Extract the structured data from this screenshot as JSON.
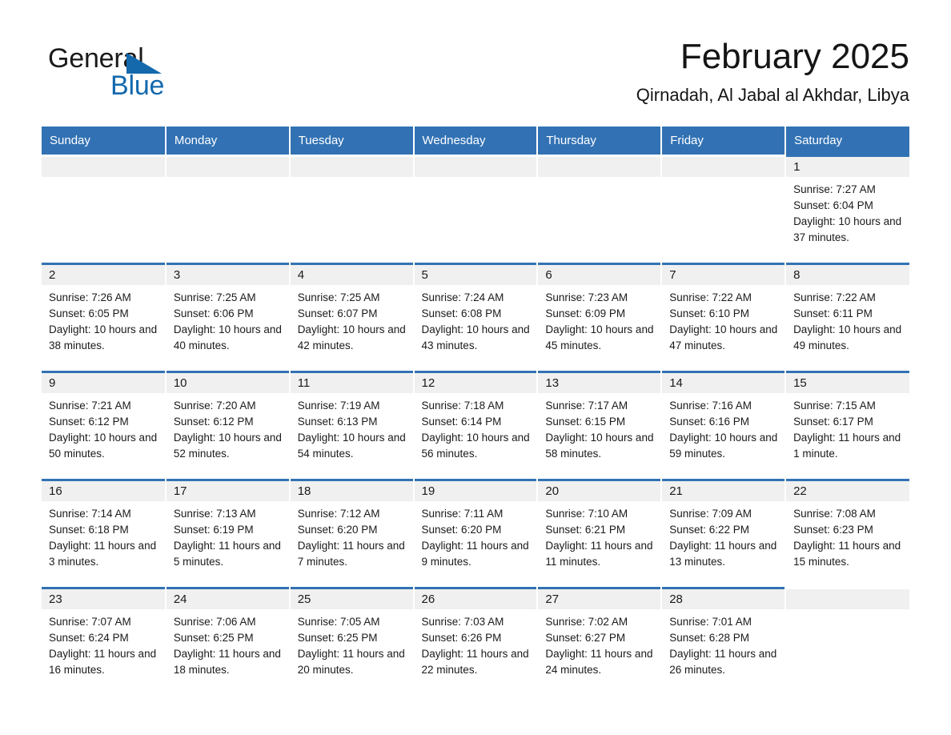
{
  "logo": {
    "word1": "General",
    "word2": "Blue",
    "triangle_color": "#1469ad",
    "word2_color": "#1469ad"
  },
  "header": {
    "title": "February 2025",
    "subtitle": "Qirnadah, Al Jabal al Akhdar, Libya"
  },
  "theme": {
    "header_blue": "#3272b4",
    "day_band_grey": "#f0f0f0",
    "text": "#1a1a1a"
  },
  "weekdays": [
    "Sunday",
    "Monday",
    "Tuesday",
    "Wednesday",
    "Thursday",
    "Friday",
    "Saturday"
  ],
  "labels": {
    "sunrise_prefix": "Sunrise:",
    "sunset_prefix": "Sunset:",
    "daylight_prefix": "Daylight:"
  },
  "weeks": [
    [
      {
        "day": "",
        "empty": true
      },
      {
        "day": "",
        "empty": true
      },
      {
        "day": "",
        "empty": true
      },
      {
        "day": "",
        "empty": true
      },
      {
        "day": "",
        "empty": true
      },
      {
        "day": "",
        "empty": true
      },
      {
        "day": "1",
        "sunrise": "Sunrise: 7:27 AM",
        "sunset": "Sunset: 6:04 PM",
        "daylight": "Daylight: 10 hours and 37 minutes."
      }
    ],
    [
      {
        "day": "2",
        "sunrise": "Sunrise: 7:26 AM",
        "sunset": "Sunset: 6:05 PM",
        "daylight": "Daylight: 10 hours and 38 minutes."
      },
      {
        "day": "3",
        "sunrise": "Sunrise: 7:25 AM",
        "sunset": "Sunset: 6:06 PM",
        "daylight": "Daylight: 10 hours and 40 minutes."
      },
      {
        "day": "4",
        "sunrise": "Sunrise: 7:25 AM",
        "sunset": "Sunset: 6:07 PM",
        "daylight": "Daylight: 10 hours and 42 minutes."
      },
      {
        "day": "5",
        "sunrise": "Sunrise: 7:24 AM",
        "sunset": "Sunset: 6:08 PM",
        "daylight": "Daylight: 10 hours and 43 minutes."
      },
      {
        "day": "6",
        "sunrise": "Sunrise: 7:23 AM",
        "sunset": "Sunset: 6:09 PM",
        "daylight": "Daylight: 10 hours and 45 minutes."
      },
      {
        "day": "7",
        "sunrise": "Sunrise: 7:22 AM",
        "sunset": "Sunset: 6:10 PM",
        "daylight": "Daylight: 10 hours and 47 minutes."
      },
      {
        "day": "8",
        "sunrise": "Sunrise: 7:22 AM",
        "sunset": "Sunset: 6:11 PM",
        "daylight": "Daylight: 10 hours and 49 minutes."
      }
    ],
    [
      {
        "day": "9",
        "sunrise": "Sunrise: 7:21 AM",
        "sunset": "Sunset: 6:12 PM",
        "daylight": "Daylight: 10 hours and 50 minutes."
      },
      {
        "day": "10",
        "sunrise": "Sunrise: 7:20 AM",
        "sunset": "Sunset: 6:12 PM",
        "daylight": "Daylight: 10 hours and 52 minutes."
      },
      {
        "day": "11",
        "sunrise": "Sunrise: 7:19 AM",
        "sunset": "Sunset: 6:13 PM",
        "daylight": "Daylight: 10 hours and 54 minutes."
      },
      {
        "day": "12",
        "sunrise": "Sunrise: 7:18 AM",
        "sunset": "Sunset: 6:14 PM",
        "daylight": "Daylight: 10 hours and 56 minutes."
      },
      {
        "day": "13",
        "sunrise": "Sunrise: 7:17 AM",
        "sunset": "Sunset: 6:15 PM",
        "daylight": "Daylight: 10 hours and 58 minutes."
      },
      {
        "day": "14",
        "sunrise": "Sunrise: 7:16 AM",
        "sunset": "Sunset: 6:16 PM",
        "daylight": "Daylight: 10 hours and 59 minutes."
      },
      {
        "day": "15",
        "sunrise": "Sunrise: 7:15 AM",
        "sunset": "Sunset: 6:17 PM",
        "daylight": "Daylight: 11 hours and 1 minute."
      }
    ],
    [
      {
        "day": "16",
        "sunrise": "Sunrise: 7:14 AM",
        "sunset": "Sunset: 6:18 PM",
        "daylight": "Daylight: 11 hours and 3 minutes."
      },
      {
        "day": "17",
        "sunrise": "Sunrise: 7:13 AM",
        "sunset": "Sunset: 6:19 PM",
        "daylight": "Daylight: 11 hours and 5 minutes."
      },
      {
        "day": "18",
        "sunrise": "Sunrise: 7:12 AM",
        "sunset": "Sunset: 6:20 PM",
        "daylight": "Daylight: 11 hours and 7 minutes."
      },
      {
        "day": "19",
        "sunrise": "Sunrise: 7:11 AM",
        "sunset": "Sunset: 6:20 PM",
        "daylight": "Daylight: 11 hours and 9 minutes."
      },
      {
        "day": "20",
        "sunrise": "Sunrise: 7:10 AM",
        "sunset": "Sunset: 6:21 PM",
        "daylight": "Daylight: 11 hours and 11 minutes."
      },
      {
        "day": "21",
        "sunrise": "Sunrise: 7:09 AM",
        "sunset": "Sunset: 6:22 PM",
        "daylight": "Daylight: 11 hours and 13 minutes."
      },
      {
        "day": "22",
        "sunrise": "Sunrise: 7:08 AM",
        "sunset": "Sunset: 6:23 PM",
        "daylight": "Daylight: 11 hours and 15 minutes."
      }
    ],
    [
      {
        "day": "23",
        "sunrise": "Sunrise: 7:07 AM",
        "sunset": "Sunset: 6:24 PM",
        "daylight": "Daylight: 11 hours and 16 minutes."
      },
      {
        "day": "24",
        "sunrise": "Sunrise: 7:06 AM",
        "sunset": "Sunset: 6:25 PM",
        "daylight": "Daylight: 11 hours and 18 minutes."
      },
      {
        "day": "25",
        "sunrise": "Sunrise: 7:05 AM",
        "sunset": "Sunset: 6:25 PM",
        "daylight": "Daylight: 11 hours and 20 minutes."
      },
      {
        "day": "26",
        "sunrise": "Sunrise: 7:03 AM",
        "sunset": "Sunset: 6:26 PM",
        "daylight": "Daylight: 11 hours and 22 minutes."
      },
      {
        "day": "27",
        "sunrise": "Sunrise: 7:02 AM",
        "sunset": "Sunset: 6:27 PM",
        "daylight": "Daylight: 11 hours and 24 minutes."
      },
      {
        "day": "28",
        "sunrise": "Sunrise: 7:01 AM",
        "sunset": "Sunset: 6:28 PM",
        "daylight": "Daylight: 11 hours and 26 minutes."
      },
      {
        "day": "",
        "empty": true,
        "trailing": true
      }
    ]
  ]
}
